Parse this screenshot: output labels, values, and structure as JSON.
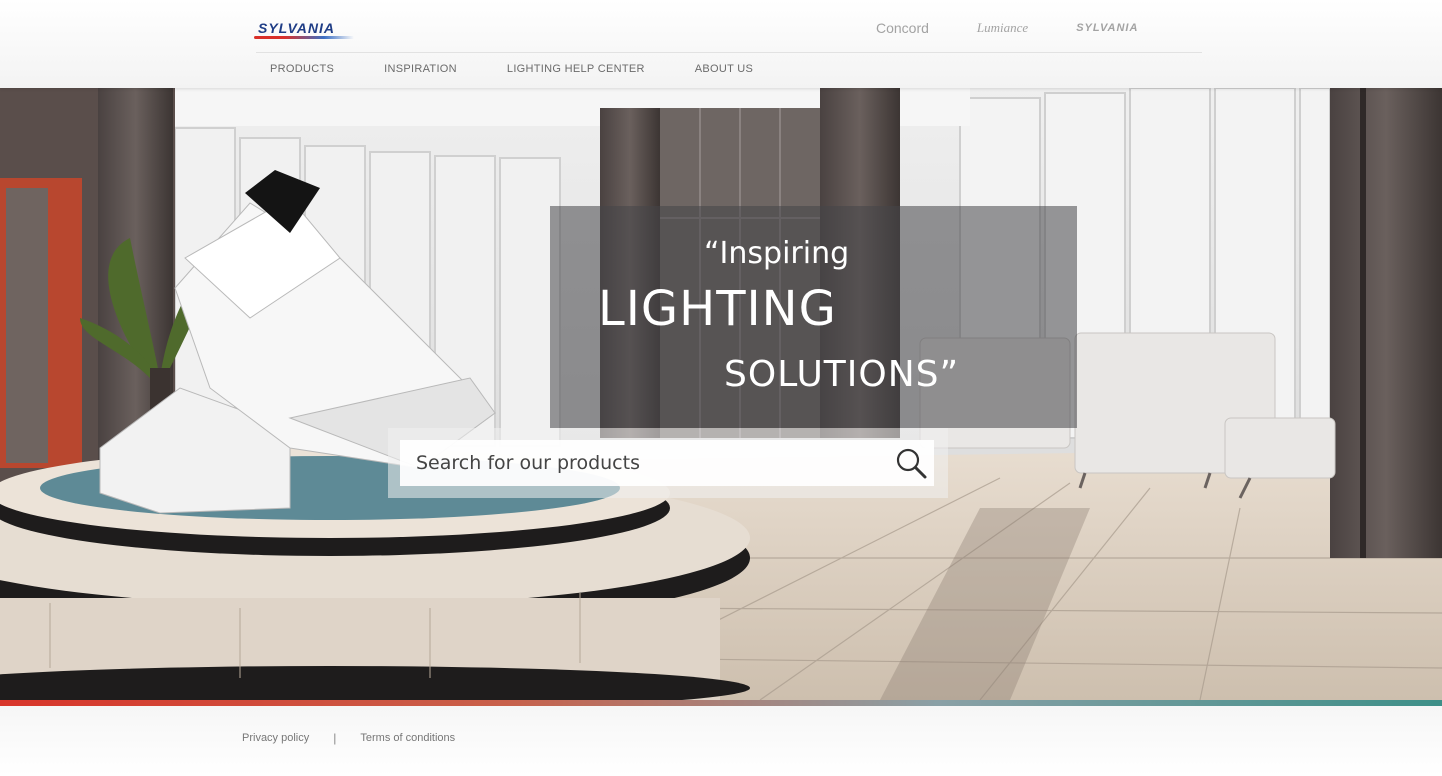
{
  "header": {
    "logo_text": "SYLVANIA",
    "brands": [
      "Concord",
      "Lumiance",
      "SYLVANIA"
    ],
    "nav": [
      "PRODUCTS",
      "INSPIRATION",
      "LIGHTING HELP CENTER",
      "ABOUT US"
    ]
  },
  "hero": {
    "tagline_line1": "“Inspiring",
    "tagline_line2": "LIGHTING",
    "tagline_line3": "SOLUTIONS”",
    "search_placeholder": "Search for our products",
    "search_icon": "search-icon"
  },
  "footer": {
    "privacy_label": "Privacy policy",
    "separator": "|",
    "terms_label": "Terms of conditions"
  },
  "colors": {
    "brand_red": "#d9302a",
    "brand_blue": "#1f3d86",
    "stripe_teal": "#3d8f88"
  }
}
